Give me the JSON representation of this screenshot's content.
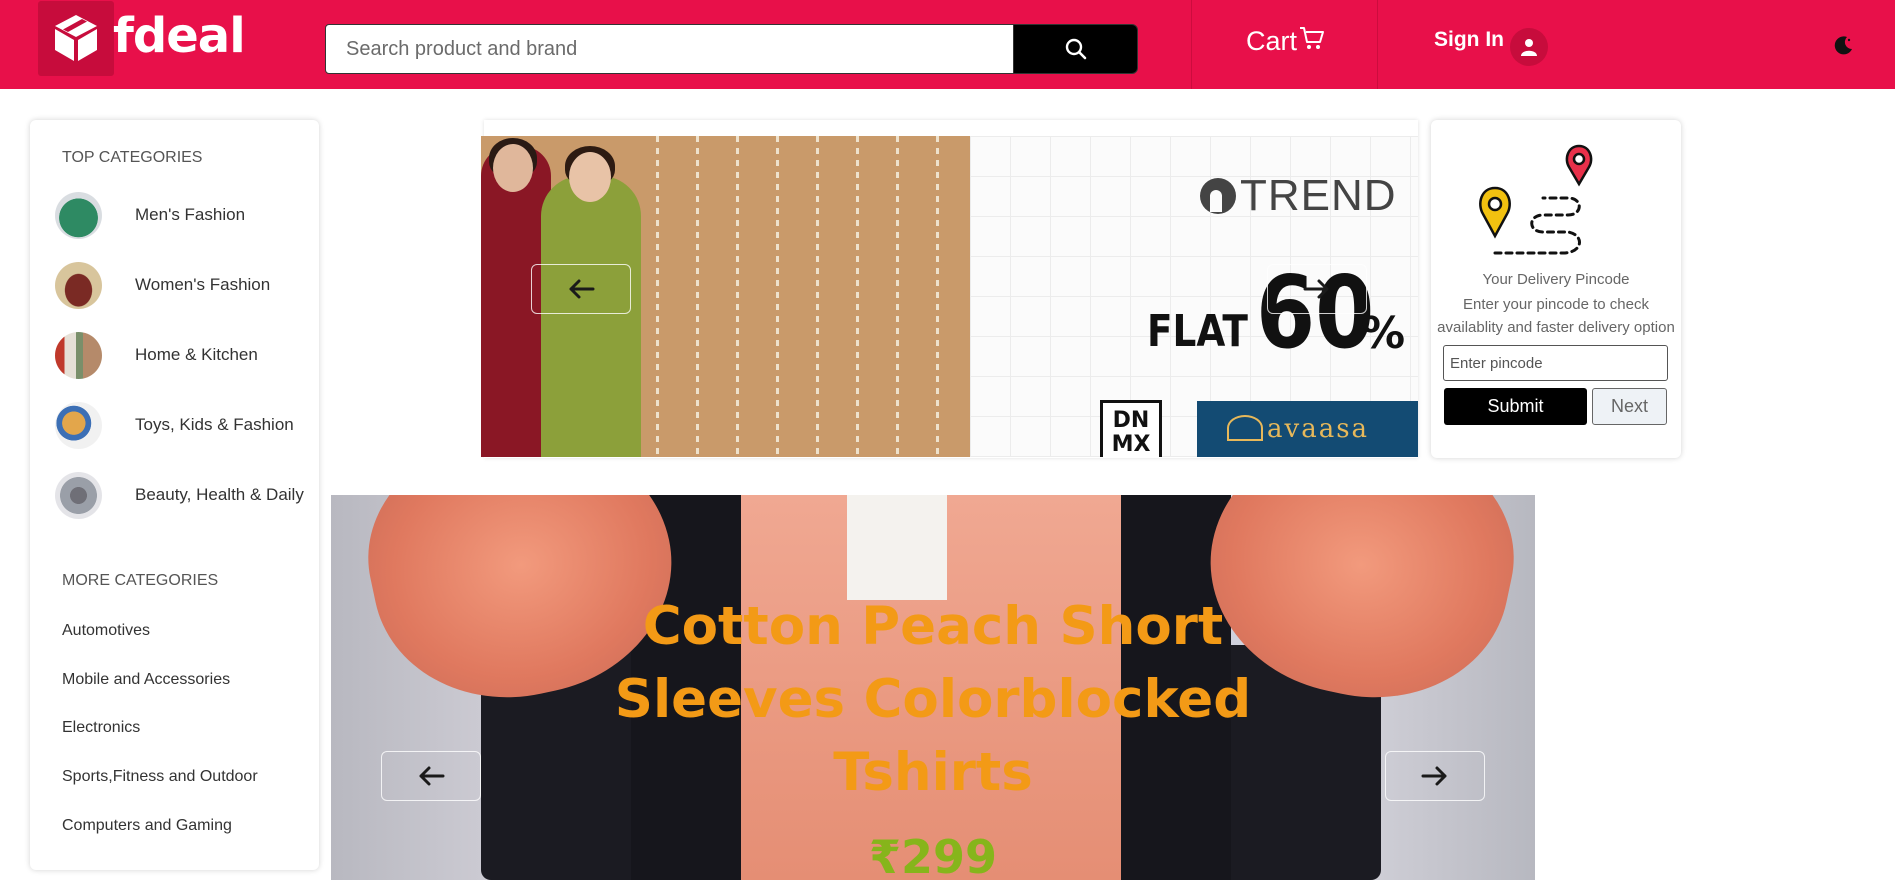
{
  "header": {
    "logo_text": "fdeal",
    "search_placeholder": "Search product and brand",
    "cart_label": "Cart",
    "signin_label": "Sign In",
    "brand_color": "#e8104a"
  },
  "sidebar": {
    "top_heading": "TOP CATEGORIES",
    "top_categories": [
      {
        "label": "Men's Fashion",
        "thumb_color": "#2e8a63"
      },
      {
        "label": "Women's Fashion",
        "thumb_color": "#7a2a24"
      },
      {
        "label": "Home & Kitchen",
        "thumb_color": "#b58a6a"
      },
      {
        "label": "Toys, Kids & Fashion",
        "thumb_color": "#e3a64b"
      },
      {
        "label": "Beauty, Health & Daily",
        "thumb_color": "#9a9fa8"
      }
    ],
    "more_heading": "MORE CATEGORIES",
    "more_categories": [
      "Automotives",
      "Mobile and Accessories",
      "Electronics",
      "Sports,Fitness and Outdoor",
      "Computers and Gaming"
    ]
  },
  "banner": {
    "brand": "TREND",
    "flat_label": "FLAT",
    "discount_value": "60",
    "percent_sign": "%",
    "brand_dnmx": "DN MX",
    "brand_avaasa": "avaasa"
  },
  "pincode": {
    "title": "Your Delivery Pincode",
    "description": "Enter your pincode to check availablity and faster delivery option",
    "input_placeholder": "Enter pincode",
    "submit_label": "Submit",
    "next_label": "Next"
  },
  "slide": {
    "title": "Cotton Peach Short Sleeves Colorblocked Tshirts",
    "price": "₹299",
    "title_color": "#f39a16",
    "price_color": "#86b51b"
  }
}
